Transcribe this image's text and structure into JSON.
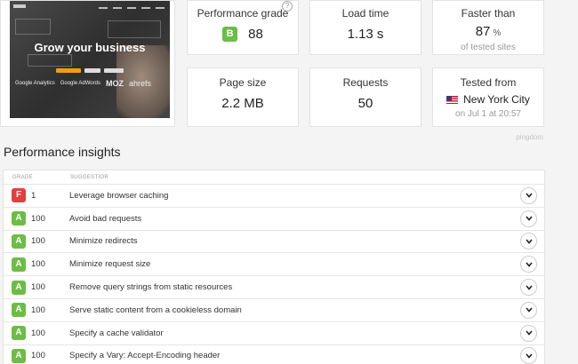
{
  "thumbnail": {
    "headline": "Grow your business",
    "logos": [
      "Google Analytics",
      "Google AdWords",
      "MOZ",
      "ahrefs"
    ]
  },
  "metrics": {
    "performance_grade": {
      "label": "Performance grade",
      "grade": "B",
      "score": "88"
    },
    "load_time": {
      "label": "Load time",
      "value": "1.13 s"
    },
    "faster_than": {
      "label": "Faster than",
      "value": "87",
      "unit": "%",
      "sub": "of tested sites"
    },
    "page_size": {
      "label": "Page size",
      "value": "2.2 MB"
    },
    "requests": {
      "label": "Requests",
      "value": "50"
    },
    "tested_from": {
      "label": "Tested from",
      "location": "New York City",
      "date": "on Jul 1 at 20:57"
    }
  },
  "brand": "pingdom",
  "insights": {
    "title": "Performance insights",
    "headers": {
      "grade": "GRADE",
      "suggestion": "SUGGESTIOR"
    },
    "rows": [
      {
        "grade": "F",
        "score": "1",
        "suggestion": "Leverage browser caching",
        "color": "#e23f3f"
      },
      {
        "grade": "A",
        "score": "100",
        "suggestion": "Avoid bad requests",
        "color": "#6cbd45"
      },
      {
        "grade": "A",
        "score": "100",
        "suggestion": "Minimize redirects",
        "color": "#6cbd45"
      },
      {
        "grade": "A",
        "score": "100",
        "suggestion": "Minimize request size",
        "color": "#6cbd45"
      },
      {
        "grade": "A",
        "score": "100",
        "suggestion": "Remove query strings from static resources",
        "color": "#6cbd45"
      },
      {
        "grade": "A",
        "score": "100",
        "suggestion": "Serve static content from a cookieless domain",
        "color": "#6cbd45"
      },
      {
        "grade": "A",
        "score": "100",
        "suggestion": "Specify a cache validator",
        "color": "#6cbd45"
      },
      {
        "grade": "A",
        "score": "100",
        "suggestion": "Specify a Vary: Accept-Encoding header",
        "color": "#6cbd45"
      }
    ]
  }
}
